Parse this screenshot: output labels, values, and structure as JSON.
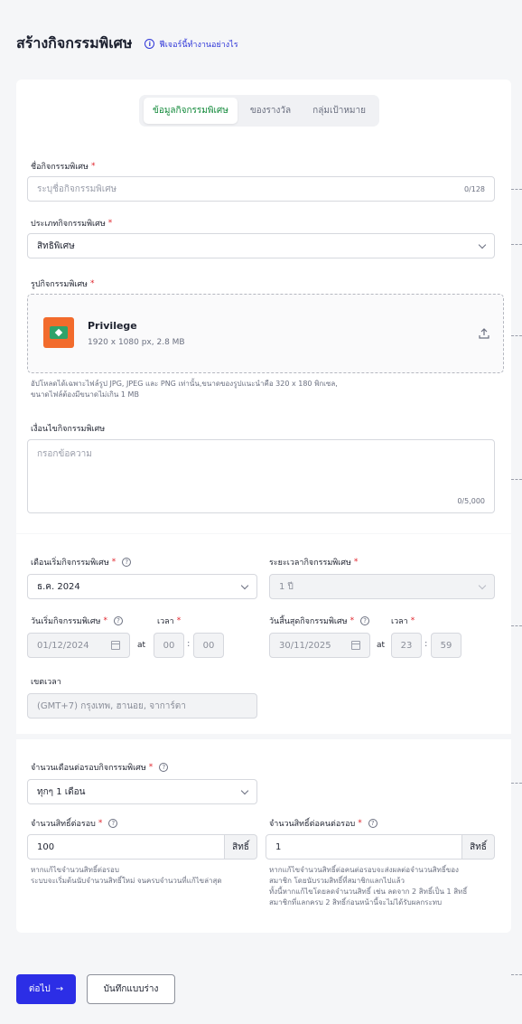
{
  "header": {
    "title": "สร้างกิจกรรมพิเศษ",
    "help_link": "ฟีเจอร์นี้ทำงานอย่างไร",
    "help_icon": "i"
  },
  "tabs": [
    "ข้อมูลกิจกรรมพิเศษ",
    "ของรางวัล",
    "กลุ่มเป้าหมาย"
  ],
  "active_tab": 0,
  "name_field": {
    "label": "ชื่อกิจกรรมพิเศษ",
    "placeholder": "ระบุชื่อกิจกรรมพิเศษ",
    "counter": "0/128"
  },
  "type_field": {
    "label": "ประเภทกิจกรรมพิเศษ",
    "value": "สิทธิพิเศษ"
  },
  "image_field": {
    "label": "รูปกิจกรรมพิเศษ",
    "file_name": "Privilege",
    "file_meta": "1920 x 1080 px, 2.8 MB",
    "help_line1": "อัปโหลดได้เฉพาะไฟล์รูป JPG, JPEG และ PNG เท่านั้น,ขนาดของรูปแนะนำคือ 320 x 180 พิกเซล,",
    "help_line2": "ขนาดไฟล์ต้องมีขนาดไม่เกิน 1 MB"
  },
  "condition_field": {
    "label": "เงื่อนไขกิจกรรมพิเศษ",
    "placeholder": "กรอกข้อความ",
    "counter": "0/5,000"
  },
  "start_month": {
    "label": "เดือนเริ่มกิจกรรมพิเศษ",
    "value": "ธ.ค. 2024"
  },
  "duration": {
    "label": "ระยะเวลากิจกรรมพิเศษ",
    "value": "1 ปี"
  },
  "start_date": {
    "label": "วันเริ่มกิจกรรมพิเศษ",
    "value": "01/12/2024",
    "time_label": "เวลา",
    "at": "at",
    "hour": "00",
    "minute": "00",
    "colon": ":"
  },
  "end_date": {
    "label": "วันสิ้นสุดกิจกรรมพิเศษ",
    "value": "30/11/2025",
    "time_label": "เวลา",
    "at": "at",
    "hour": "23",
    "minute": "59",
    "colon": ":"
  },
  "timezone": {
    "label": "เขตเวลา",
    "value": "(GMT+7) กรุงเทพ, ฮานอย, จาการ์ตา"
  },
  "months_per_round": {
    "label": "จำนวนเดือนต่อรอบกิจกรรมพิเศษ",
    "value": "ทุกๆ 1 เดือน"
  },
  "rights_per_round": {
    "label": "จำนวนสิทธิ์ต่อรอบ",
    "value": "100",
    "suffix": "สิทธิ์",
    "help_line1": "หากแก้ไขจำนวนสิทธิ์ต่อรอบ",
    "help_line2": "ระบบจะเริ่มต้นนับจำนวนสิทธิ์ใหม่ จนครบจำนวนที่แก้ไขล่าสุด"
  },
  "rights_per_person": {
    "label": "จำนวนสิทธิ์ต่อคนต่อรอบ",
    "value": "1",
    "suffix": "สิทธิ์",
    "help_line1": "หากแก้ไขจำนวนสิทธิ์ต่อคนต่อรอบจะส่งผลต่อจำนวนสิทธิ์ของ",
    "help_line2": "สมาชิก โดยนับรวมสิทธิ์ที่สมาชิกแลกไปแล้ว",
    "help_line3": "ทั้งนี้หากแก้ไขโดยลดจำนวนสิทธิ์ เช่น ลดจาก 2 สิทธิ์เป็น 1 สิทธิ์",
    "help_line4": "สมาชิกที่แลกครบ 2 สิทธิ์ก่อนหน้านี้จะไม่ได้รับผลกระทบ"
  },
  "required_mark": "*",
  "question_mark": "?",
  "buttons": {
    "next": "ต่อไป",
    "next_arrow": "→",
    "save_draft": "บันทึกแบบร่าง"
  },
  "colors": {
    "primary": "#2c2ee6",
    "active_tab": "#138a3b",
    "required": "#e0232b",
    "link": "#2f36d8"
  }
}
